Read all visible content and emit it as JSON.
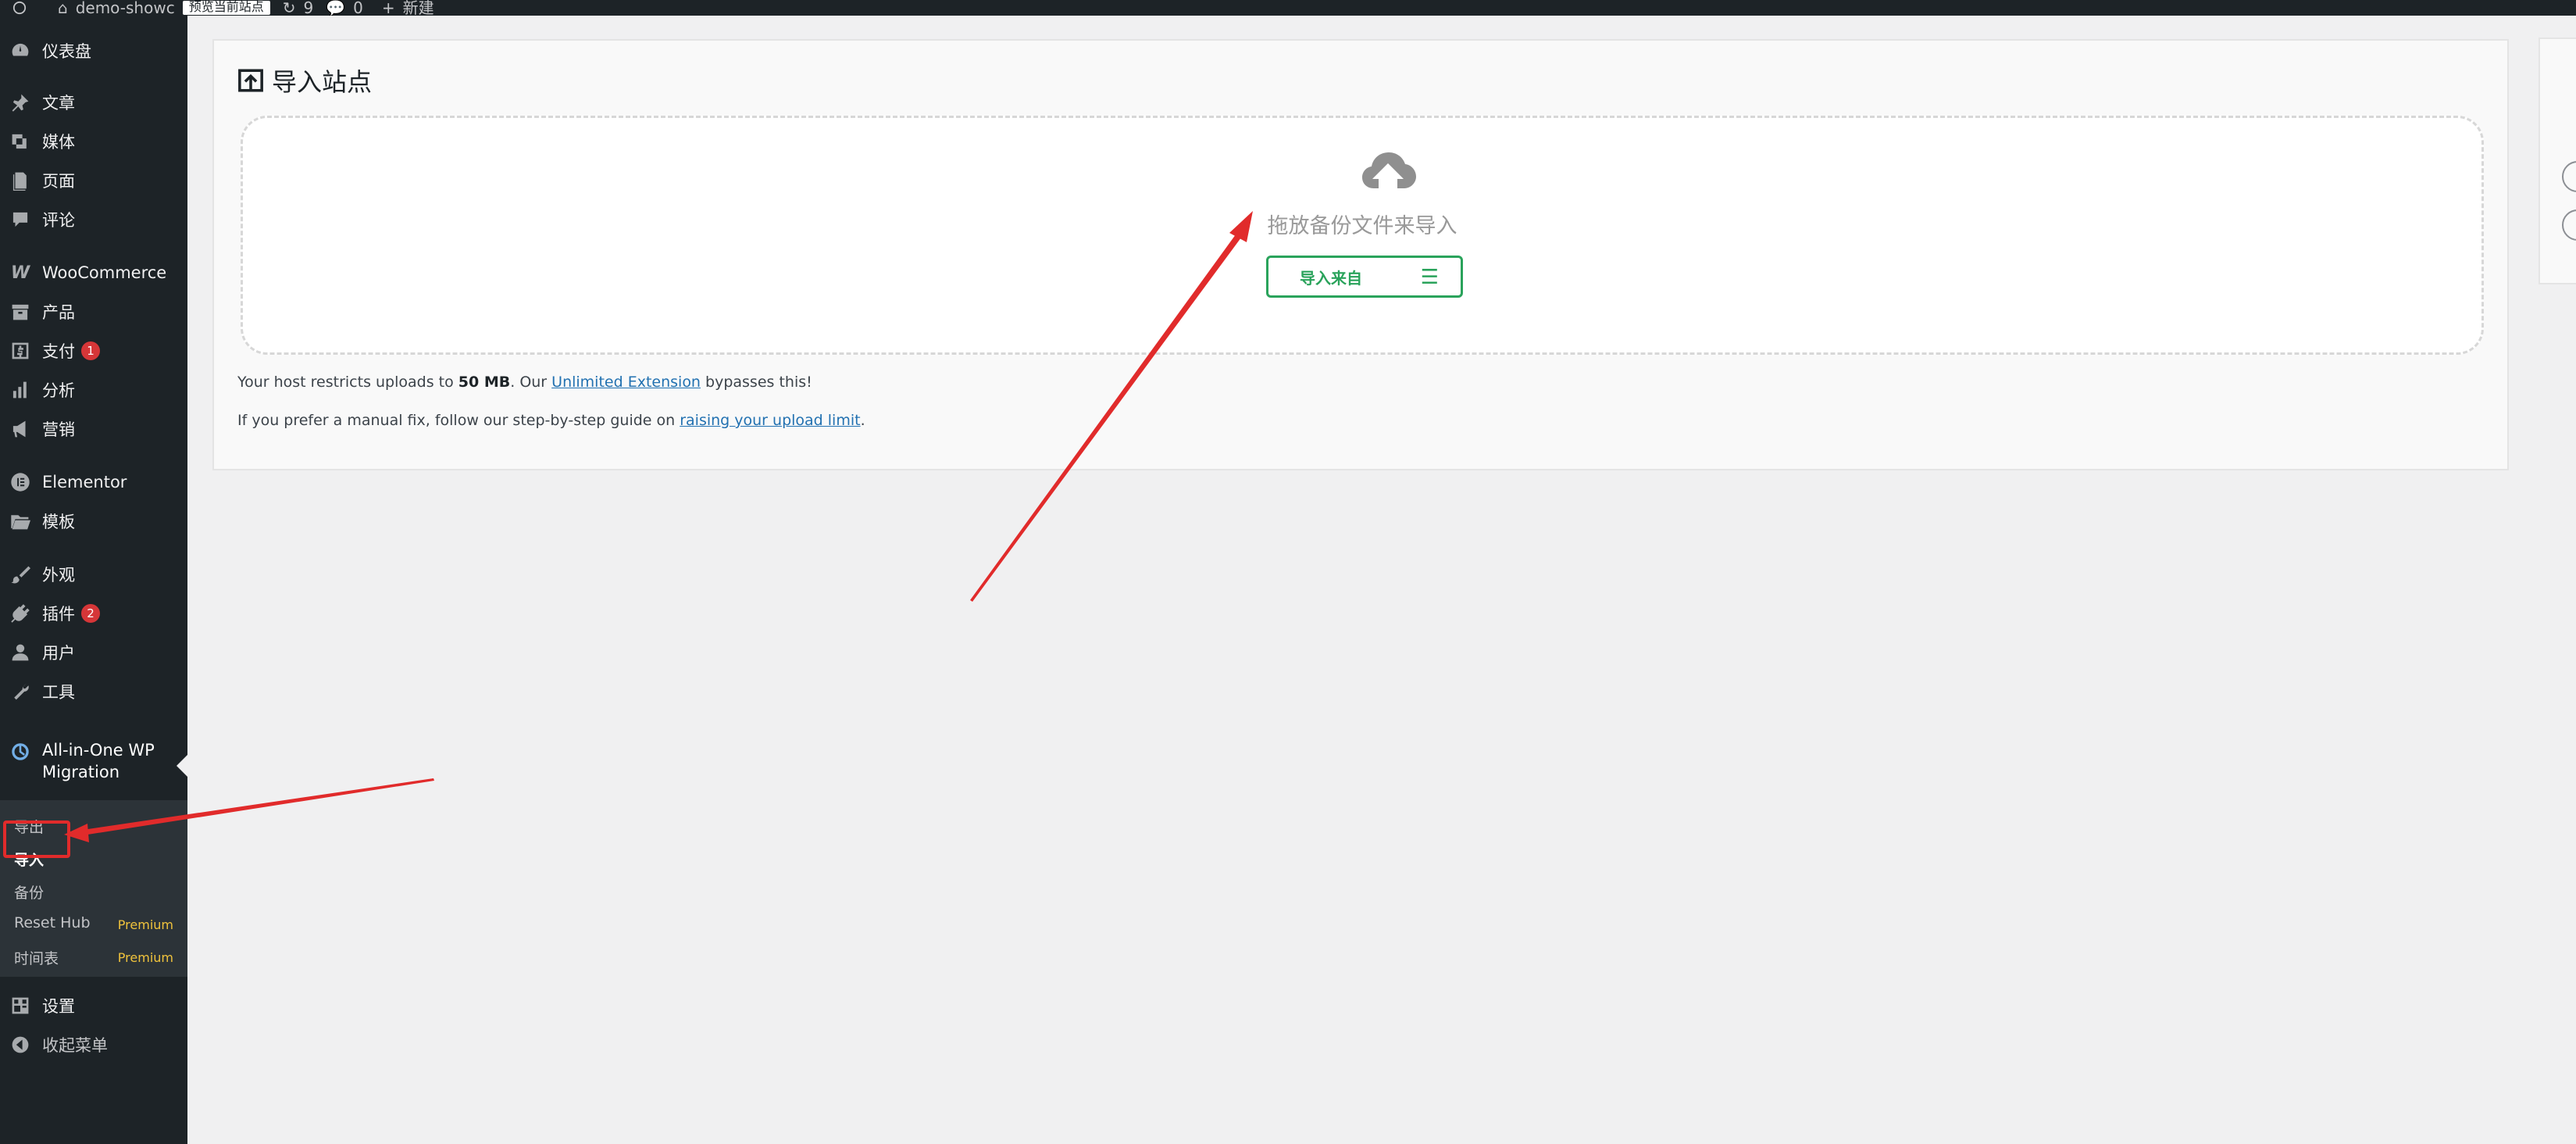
{
  "admin_bar": {
    "site_name": "demo-showc",
    "badge": "预览当前站点",
    "updates": "9",
    "comments": "0",
    "new_label": "新建"
  },
  "sidebar": {
    "items": [
      {
        "label": "仪表盘",
        "icon": "dashboard-icon"
      },
      {
        "label": "文章",
        "icon": "pin-icon"
      },
      {
        "label": "媒体",
        "icon": "media-icon"
      },
      {
        "label": "页面",
        "icon": "page-icon"
      },
      {
        "label": "评论",
        "icon": "comment-icon"
      },
      {
        "label": "WooCommerce",
        "icon": "woocommerce-icon"
      },
      {
        "label": "产品",
        "icon": "archive-icon"
      },
      {
        "label": "支付",
        "icon": "dollar-icon",
        "badge": "1"
      },
      {
        "label": "分析",
        "icon": "bar-chart-icon"
      },
      {
        "label": "营销",
        "icon": "megaphone-icon"
      },
      {
        "label": "Elementor",
        "icon": "elementor-icon"
      },
      {
        "label": "模板",
        "icon": "folder-icon"
      },
      {
        "label": "外观",
        "icon": "brush-icon"
      },
      {
        "label": "插件",
        "icon": "plugin-icon",
        "badge": "2"
      },
      {
        "label": "用户",
        "icon": "user-icon"
      },
      {
        "label": "工具",
        "icon": "wrench-icon"
      },
      {
        "label": "设置",
        "icon": "settings-icon"
      },
      {
        "label": "收起菜单",
        "icon": "collapse-icon"
      }
    ],
    "active": {
      "label_line1": "All-in-One WP",
      "label_line2": "Migration",
      "icon": "migration-icon"
    },
    "submenu": [
      {
        "label": "导出"
      },
      {
        "label": "导入",
        "current": true
      },
      {
        "label": "备份"
      },
      {
        "label": "Reset Hub",
        "tag": "Premium"
      },
      {
        "label": "时间表",
        "tag": "Premium"
      }
    ]
  },
  "main": {
    "title": "导入站点",
    "drop_text": "拖放备份文件来导入",
    "import_button": "导入来自",
    "import_menu_glyph": "☰",
    "line1": {
      "pre": "Your host restricts uploads to ",
      "size": "50 MB",
      "mid": ". Our ",
      "link": "Unlimited Extension",
      "post": " bypasses this!"
    },
    "line2": {
      "pre": "If you prefer a manual fix, follow our step-by-step guide on ",
      "link": "raising your upload limit",
      "post": "."
    }
  },
  "colors": {
    "sidebar_bg": "#1d2327",
    "submenu_bg": "#2c3338",
    "accent_green": "#2aa35b",
    "link_blue": "#2271b1",
    "badge_red": "#d63638",
    "annotation_red": "#e12b2b",
    "premium_yellow": "#f0c33c"
  }
}
